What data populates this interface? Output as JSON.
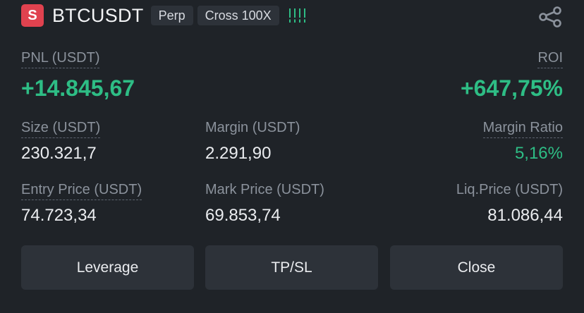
{
  "position": {
    "side_badge": "S",
    "symbol": "BTCUSDT",
    "type_tag": "Perp",
    "margin_mode_tag": "Cross 100X",
    "risk_indicator_icon": "risk-bars-icon",
    "share_icon": "share-icon"
  },
  "pnl": {
    "label": "PNL (USDT)",
    "value": "+14.845,67"
  },
  "roi": {
    "label": "ROI",
    "value": "+647,75%"
  },
  "size": {
    "label": "Size (USDT)",
    "value": "230.321,7"
  },
  "margin": {
    "label": "Margin (USDT)",
    "value": "2.291,90"
  },
  "margin_ratio": {
    "label": "Margin Ratio",
    "value": "5,16%"
  },
  "entry_price": {
    "label": "Entry Price (USDT)",
    "value": "74.723,34"
  },
  "mark_price": {
    "label": "Mark Price (USDT)",
    "value": "69.853,74"
  },
  "liq_price": {
    "label": "Liq.Price (USDT)",
    "value": "81.086,44"
  },
  "actions": {
    "leverage": "Leverage",
    "tpsl": "TP/SL",
    "close": "Close"
  },
  "colors": {
    "background": "#1f2328",
    "profit_green": "#2ebd85",
    "short_red": "#e0424f",
    "button_bg": "#2d3239"
  }
}
